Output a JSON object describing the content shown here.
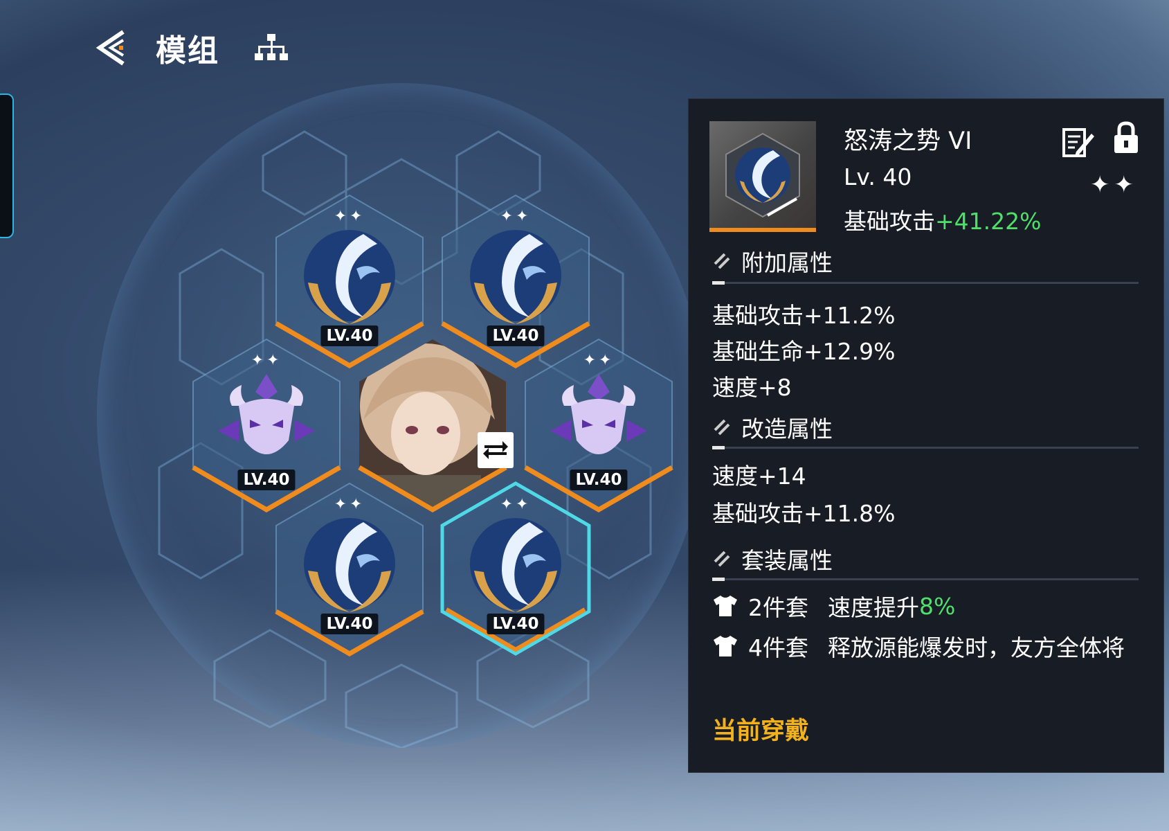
{
  "header": {
    "title": "模组"
  },
  "slots": [
    {
      "level_label": "LV.40",
      "stars": "✦✦",
      "icon": "storm-wave-emblem-icon",
      "selected": false
    },
    {
      "level_label": "LV.40",
      "stars": "✦✦",
      "icon": "storm-wave-emblem-icon",
      "selected": false
    },
    {
      "level_label": "LV.40",
      "stars": "✦✦",
      "icon": "dragon-crest-icon",
      "selected": false
    },
    {
      "level_label": "LV.40",
      "stars": "✦✦",
      "icon": "dragon-crest-icon",
      "selected": false
    },
    {
      "level_label": "LV.40",
      "stars": "✦✦",
      "icon": "storm-wave-emblem-icon",
      "selected": false
    },
    {
      "level_label": "LV.40",
      "stars": "✦✦",
      "icon": "storm-wave-emblem-icon",
      "selected": true
    }
  ],
  "detail": {
    "name": "怒涛之势 VI",
    "level": "Lv. 40",
    "main_stat_label": "基础攻击",
    "main_stat_value": "+41.22%",
    "stars": "✦✦",
    "bonus_title": "附加属性",
    "bonus_stats": [
      "基础攻击+11.2%",
      "基础生命+12.9%",
      "速度+8"
    ],
    "reform_title": "改造属性",
    "reform_stats": [
      "速度+14",
      "基础攻击+11.8%"
    ],
    "set_title": "套装属性",
    "sets": [
      {
        "count": "2件套",
        "text": "速度提升",
        "value": "8%"
      },
      {
        "count": "4件套",
        "text": "释放源能爆发时，友方全体将",
        "value": ""
      }
    ],
    "equipped_label": "当前穿戴"
  },
  "colors": {
    "accent_orange": "#f08c1e",
    "selected_cyan": "#4fd8e6",
    "positive_green": "#4fe06a",
    "equipped_yellow": "#f3b21c",
    "panel_bg": "#181d25"
  }
}
